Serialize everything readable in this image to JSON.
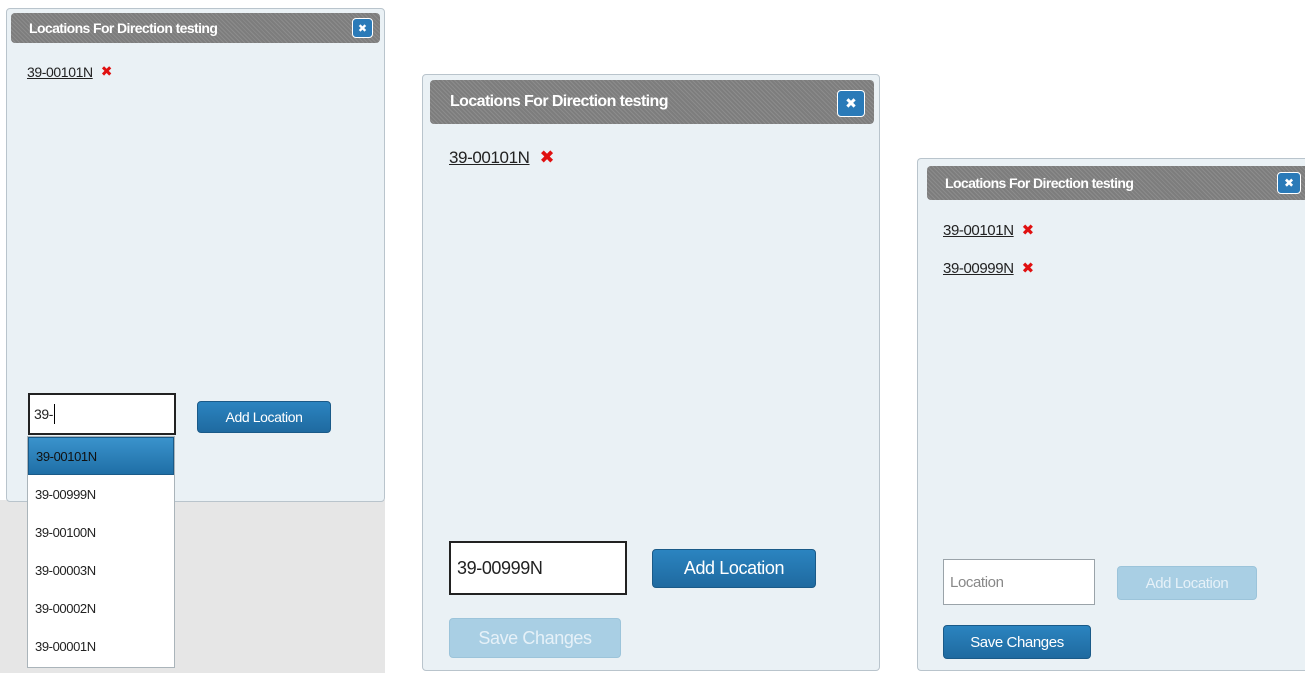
{
  "panels": [
    {
      "title": "Locations For Direction testing",
      "close_glyph": "✖",
      "locations": [
        {
          "code": "39-00101N"
        }
      ],
      "input_value": "39-",
      "add_label": "Add Location",
      "dropdown": [
        "39-00101N",
        "39-00999N",
        "39-00100N",
        "39-00003N",
        "39-00002N",
        "39-00001N"
      ]
    },
    {
      "title": "Locations For Direction testing",
      "close_glyph": "✖",
      "locations": [
        {
          "code": "39-00101N"
        }
      ],
      "input_value": "39-00999N",
      "add_label": "Add Location",
      "save_label": "Save Changes"
    },
    {
      "title": "Locations For Direction testing",
      "close_glyph": "✖",
      "locations": [
        {
          "code": "39-00101N"
        },
        {
          "code": "39-00999N"
        }
      ],
      "input_placeholder": "Location",
      "add_label": "Add Location",
      "save_label": "Save Changes"
    }
  ],
  "remove_glyph": "✖",
  "colors": {
    "accent": "#2a7ab8",
    "remove": "#e01010",
    "panel_bg": "#eaf1f5",
    "titlebar": "#858585"
  }
}
